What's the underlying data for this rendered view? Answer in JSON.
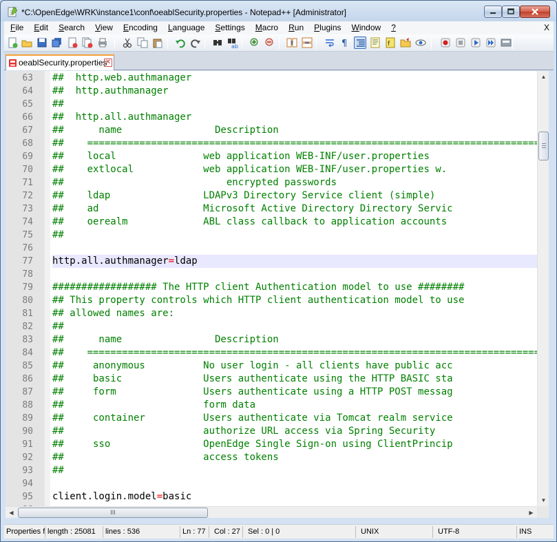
{
  "window": {
    "title": "*C:\\OpenEdge\\WRK\\instance1\\conf\\oeablSecurity.properties - Notepad++ [Administrator]"
  },
  "menu": {
    "items": [
      {
        "label": "File",
        "name": "file"
      },
      {
        "label": "Edit",
        "name": "edit"
      },
      {
        "label": "Search",
        "name": "search"
      },
      {
        "label": "View",
        "name": "view"
      },
      {
        "label": "Encoding",
        "name": "encoding"
      },
      {
        "label": "Language",
        "name": "language"
      },
      {
        "label": "Settings",
        "name": "settings"
      },
      {
        "label": "Macro",
        "name": "macro"
      },
      {
        "label": "Run",
        "name": "run"
      },
      {
        "label": "Plugins",
        "name": "plugins"
      },
      {
        "label": "Window",
        "name": "window"
      },
      {
        "label": "?",
        "name": "help"
      }
    ],
    "close_label": "X"
  },
  "toolbar": {
    "icons": [
      "new-file-icon",
      "open-file-icon",
      "save-icon",
      "save-all-icon",
      "close-icon",
      "close-all-icon",
      "print-icon",
      "cut-icon",
      "copy-icon",
      "paste-icon",
      "undo-icon",
      "redo-icon",
      "find-icon",
      "replace-icon",
      "zoom-in-icon",
      "zoom-out-icon",
      "sync-vertical-icon",
      "sync-horizontal-icon",
      "word-wrap-icon",
      "show-all-characters-icon",
      "indent-guide-icon",
      "document-map-icon",
      "function-list-icon",
      "folder-as-workspace-icon",
      "monitoring-icon",
      "record-macro-icon",
      "stop-recording-icon",
      "playback-macro-icon",
      "run-macro-multiple-icon",
      "save-macro-icon"
    ],
    "active_icon": "indent-guide-icon"
  },
  "tab": {
    "label": "oeablSecurity.properties",
    "close_label": "✕"
  },
  "editor": {
    "current_line": 77,
    "lines": [
      {
        "n": "63",
        "text": "##  http.web.authmanager",
        "kind": "comment"
      },
      {
        "n": "64",
        "text": "##  http.authmanager",
        "kind": "comment"
      },
      {
        "n": "65",
        "text": "##",
        "kind": "comment"
      },
      {
        "n": "66",
        "text": "##  http.all.authmanager",
        "kind": "comment"
      },
      {
        "n": "67",
        "text": "##      name                Description",
        "kind": "comment"
      },
      {
        "n": "68",
        "text": "##    =================================================================================",
        "kind": "comment"
      },
      {
        "n": "69",
        "text": "##    local               web application WEB-INF/user.properties",
        "kind": "comment"
      },
      {
        "n": "70",
        "text": "##    extlocal            web application WEB-INF/user.properties w.",
        "kind": "comment"
      },
      {
        "n": "71",
        "text": "##                            encrypted passwords",
        "kind": "comment"
      },
      {
        "n": "72",
        "text": "##    ldap                LDAPv3 Directory Service client (simple)",
        "kind": "comment"
      },
      {
        "n": "73",
        "text": "##    ad                  Microsoft Active Directory Directory Servic",
        "kind": "comment"
      },
      {
        "n": "74",
        "text": "##    oerealm             ABL class callback to application accounts",
        "kind": "comment"
      },
      {
        "n": "75",
        "text": "##",
        "kind": "comment"
      },
      {
        "n": "76",
        "text": "",
        "kind": "comment"
      },
      {
        "n": "77",
        "key": "http.all.authmanager",
        "value": "ldap",
        "kind": "prop"
      },
      {
        "n": "78",
        "text": "",
        "kind": "comment"
      },
      {
        "n": "79",
        "text": "################## The HTTP client Authentication model to use ########",
        "kind": "comment"
      },
      {
        "n": "80",
        "text": "## This property controls which HTTP client authentication model to use",
        "kind": "comment"
      },
      {
        "n": "81",
        "text": "## allowed names are:",
        "kind": "comment"
      },
      {
        "n": "82",
        "text": "##",
        "kind": "comment"
      },
      {
        "n": "83",
        "text": "##      name                Description",
        "kind": "comment"
      },
      {
        "n": "84",
        "text": "##    =================================================================================",
        "kind": "comment"
      },
      {
        "n": "85",
        "text": "##     anonymous          No user login - all clients have public acc",
        "kind": "comment"
      },
      {
        "n": "86",
        "text": "##     basic              Users authenticate using the HTTP BASIC sta",
        "kind": "comment"
      },
      {
        "n": "87",
        "text": "##     form               Users authenticate using a HTTP POST messag",
        "kind": "comment"
      },
      {
        "n": "88",
        "text": "##                        form data",
        "kind": "comment"
      },
      {
        "n": "89",
        "text": "##     container          Users authenticate via Tomcat realm service",
        "kind": "comment"
      },
      {
        "n": "90",
        "text": "##                        authorize URL access via Spring Security",
        "kind": "comment"
      },
      {
        "n": "91",
        "text": "##     sso                OpenEdge Single Sign-on using ClientPrincip",
        "kind": "comment"
      },
      {
        "n": "92",
        "text": "##                        access tokens",
        "kind": "comment"
      },
      {
        "n": "93",
        "text": "##",
        "kind": "comment"
      },
      {
        "n": "94",
        "text": "",
        "kind": "comment"
      },
      {
        "n": "95",
        "key": "client.login.model",
        "value": "basic",
        "kind": "prop"
      },
      {
        "n": "96",
        "text": "",
        "kind": "comment"
      }
    ]
  },
  "scrollbars": {
    "up_arrow": "▲",
    "down_arrow": "▼",
    "left_arrow": "◀",
    "right_arrow": "▶",
    "h_grip": "III"
  },
  "status": {
    "file_type": "Properties file",
    "length": "length : 25081",
    "lines": "lines : 536",
    "ln": "Ln : 77",
    "col": "Col : 27",
    "sel": "Sel : 0 | 0",
    "eol": "UNIX",
    "encoding": "UTF-8",
    "mode": "INS"
  },
  "colors": {
    "comment": "#008000",
    "operator": "#ee0000",
    "current_line": "#e8e8ff",
    "tab_accent": "#f7a23a"
  }
}
